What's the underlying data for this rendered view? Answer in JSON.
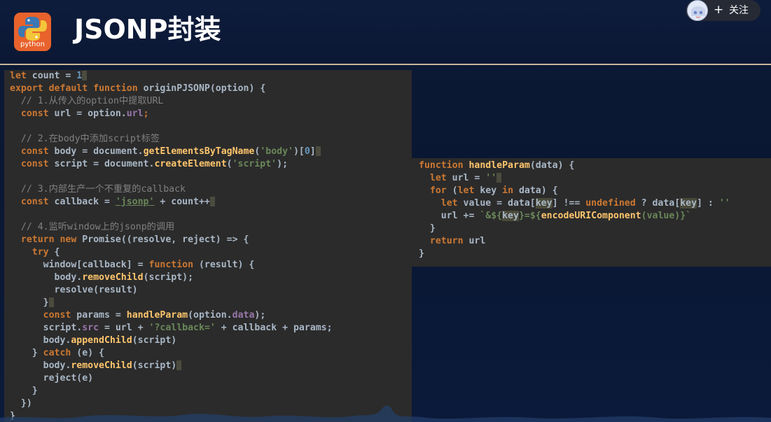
{
  "header": {
    "title": "JSONP封装",
    "logo_text": "python",
    "logo_icon": "python-logo-icon",
    "follow_plus": "+",
    "follow_label": "关注"
  },
  "left_code": {
    "l1": {
      "a": "let",
      "b": " count = ",
      "c": "1"
    },
    "l2": {
      "a": "export",
      "b": " ",
      "c": "default",
      "d": " ",
      "e": "function",
      "f": " originPJSONP(option) {"
    },
    "l3": {
      "a": "  // 1.从传入的option中提取URL"
    },
    "l4": {
      "a": "  const",
      "b": " url = option.",
      "c": "url",
      "d": ";"
    },
    "l6": {
      "a": "  // 2.在body中添加script标签"
    },
    "l7": {
      "a": "  const",
      "b": " body = document.",
      "c": "getElementsByTagName",
      "d": "(",
      "e": "'body'",
      "f": ")[",
      "g": "0",
      "h": "]"
    },
    "l8": {
      "a": "  const",
      "b": " script = document.",
      "c": "createElement",
      "d": "(",
      "e": "'script'",
      "f": ");"
    },
    "l10": {
      "a": "  // 3.内部生产一个不重复的callback"
    },
    "l11": {
      "a": "  const",
      "b": " callback = ",
      "c": "'jsonp'",
      "d": " + count++"
    },
    "l13": {
      "a": "  // 4.监听window上的jsonp的调用"
    },
    "l14": {
      "a": "  return",
      "b": " ",
      "c": "new",
      "d": " Promise((resolve, reject) => {"
    },
    "l15": {
      "a": "    try",
      "b": " {"
    },
    "l16": {
      "a": "      window[callback] = ",
      "b": "function",
      "c": " (result) {"
    },
    "l17": {
      "a": "        body.",
      "b": "removeChild",
      "c": "(script);"
    },
    "l18": {
      "a": "        resolve(result)"
    },
    "l19": {
      "a": "      }"
    },
    "l20": {
      "a": "      const",
      "b": " params = ",
      "c": "handleParam",
      "d": "(option.",
      "e": "data",
      "f": ");"
    },
    "l21": {
      "a": "      script.",
      "b": "src",
      "c": " = url + ",
      "d": "'?callback='",
      "e": " + callback + params;"
    },
    "l22": {
      "a": "      body.",
      "b": "appendChild",
      "c": "(script)"
    },
    "l23": {
      "a": "    } ",
      "b": "catch",
      "c": " (e) {"
    },
    "l24": {
      "a": "      body.",
      "b": "removeChild",
      "c": "(script)"
    },
    "l25": {
      "a": "      reject(e)"
    },
    "l26": {
      "a": "    }"
    },
    "l27": {
      "a": "  })"
    },
    "l28": {
      "a": "}"
    }
  },
  "right_code": {
    "r1": {
      "a": "function",
      "b": " ",
      "c": "handleParam",
      "d": "(data) {"
    },
    "r2": {
      "a": "  let",
      "b": " url = ",
      "c": "''"
    },
    "r3": {
      "a": "  for",
      "b": " (",
      "c": "let",
      "d": " key ",
      "e": "in",
      "f": " data) {"
    },
    "r4": {
      "a": "    let",
      "b": " value = data[",
      "c": "key",
      "d": "] !== ",
      "e": "undefined",
      "f": " ? data[",
      "g": "key",
      "h": "] : ",
      "i": "''"
    },
    "r5": {
      "a": "    url += ",
      "b": "`&${",
      "c": "key",
      "d": "}=${",
      "e": "encodeURIComponent",
      "f": "(value)}`"
    },
    "r6": {
      "a": "  }"
    },
    "r7": {
      "a": "  return",
      "b": " url"
    },
    "r8": {
      "a": "}"
    }
  }
}
